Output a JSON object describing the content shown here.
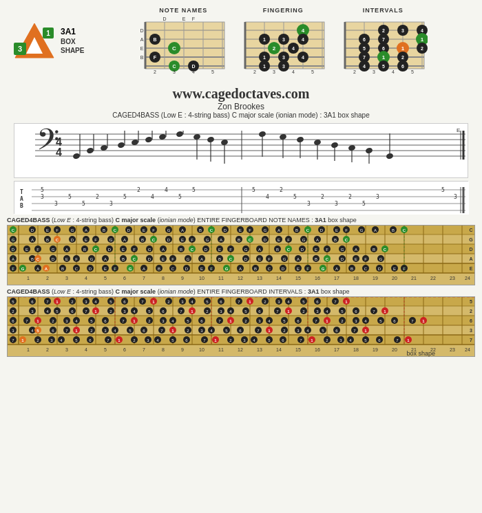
{
  "site": {
    "url": "www.cagedoctaves.com",
    "author": "Zon Brookes",
    "description_prefix": "CAGED4BASS (Low E : 4-string bass) C major scale (ionian mode) : 3A1 box shape"
  },
  "logo": {
    "label_3a1": "3A1",
    "label_box": "BOX",
    "label_shape": "SHAPE"
  },
  "diagrams": [
    {
      "title": "NOTE NAMES"
    },
    {
      "title": "FINGERING"
    },
    {
      "title": "INTERVALS"
    }
  ],
  "fingerboard_notes": {
    "title1_bold": "CAGED4BASS",
    "title1_italic1": "Low E",
    "title1_mid": ": 4-string bass)",
    "title1_bold2": "C major scale",
    "title1_italic2": "ionian mode",
    "title1_end": "ENTIRE FINGERBOARD  NOTE NAMES : 3A1 box shape",
    "title2_end": "ENTIRE FINGERBOARD  INTERVALS : 3A1 box shape"
  },
  "fret_numbers": [
    "1",
    "2",
    "3",
    "4",
    "5",
    "6",
    "7",
    "8",
    "9",
    "10",
    "11",
    "12",
    "13",
    "14",
    "15",
    "16",
    "17",
    "18",
    "19",
    "20",
    "21",
    "22",
    "23",
    "24"
  ],
  "strings_note_names": [
    "C",
    "G",
    "D",
    "A",
    "E"
  ],
  "strings_intervals": [
    "5",
    "2",
    "6",
    "3",
    "7"
  ],
  "colors": {
    "background": "#f5f5f0",
    "fingerboard": "#e8d5a0",
    "green": "#2a8c2a",
    "orange": "#e07020",
    "black": "#222222",
    "white": "#ffffff",
    "red": "#cc2222"
  }
}
